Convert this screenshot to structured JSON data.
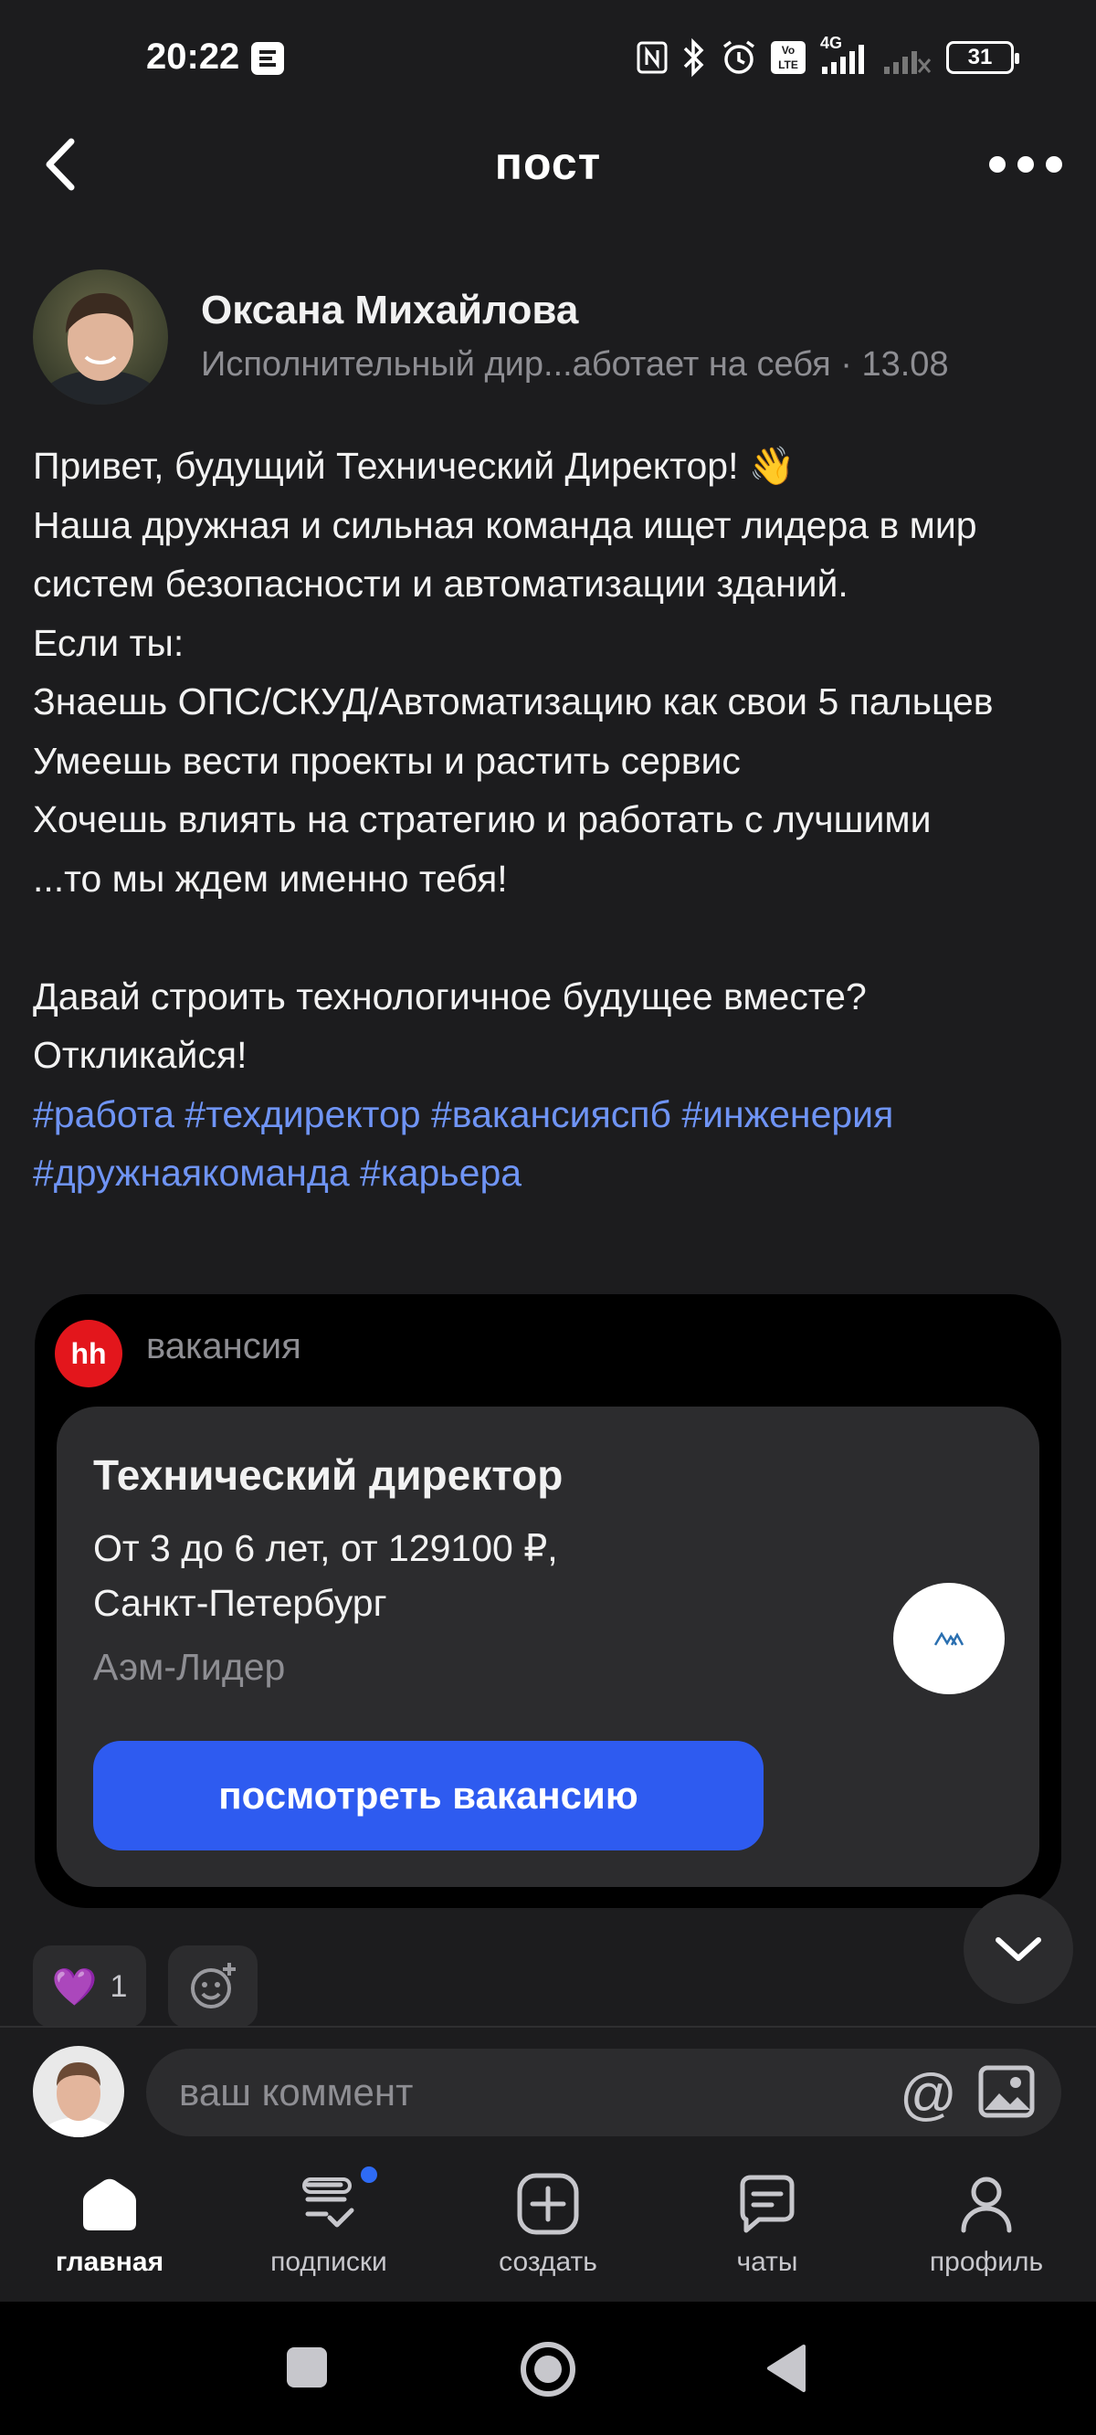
{
  "status_bar": {
    "time": "20:22",
    "network": "4G",
    "volte": "Vo LTE",
    "battery": "31"
  },
  "header": {
    "title": "пост"
  },
  "author": {
    "name": "Оксана Михайлова",
    "meta": "Исполнительный дир...аботает на себя · 13.08"
  },
  "post": {
    "lines": [
      "Привет, будущий Технический Директор! 👋",
      "Наша дружная и сильная команда ищет лидера в мир систем безопасности и автоматизации зданий.",
      "Если ты:",
      "Знаешь ОПС/СКУД/Автоматизацию как свои 5 пальцев",
      "Умеешь вести проекты и растить сервис",
      "Хочешь влиять на стратегию и работать с лучшими",
      "...то мы ждем именно тебя!",
      "Давай строить технологичное будущее вместе?",
      "Откликайся!"
    ],
    "hashtags": "#работа #техдиректор #вакансияспб #инженерия #дружнаякоманда #карьера"
  },
  "vacancy": {
    "source_logo": "hh",
    "tag": "вакансия",
    "title": "Технический директор",
    "conditions": "От 3 до 6 лет, от 129100 ₽, Санкт-Петербург",
    "company": "Аэм-Лидер",
    "button": "посмотреть вакансию"
  },
  "reactions": {
    "emoji": "💜",
    "count": "1"
  },
  "comment": {
    "placeholder": "ваш коммент",
    "at_symbol": "@"
  },
  "nav": {
    "home": "главная",
    "subscriptions": "подписки",
    "create": "создать",
    "chats": "чаты",
    "profile": "профиль"
  },
  "colors": {
    "background": "#1c1c1e",
    "accent": "#2e5bf0",
    "hashtag": "#6f94f5",
    "hh_red": "#e3161c"
  }
}
